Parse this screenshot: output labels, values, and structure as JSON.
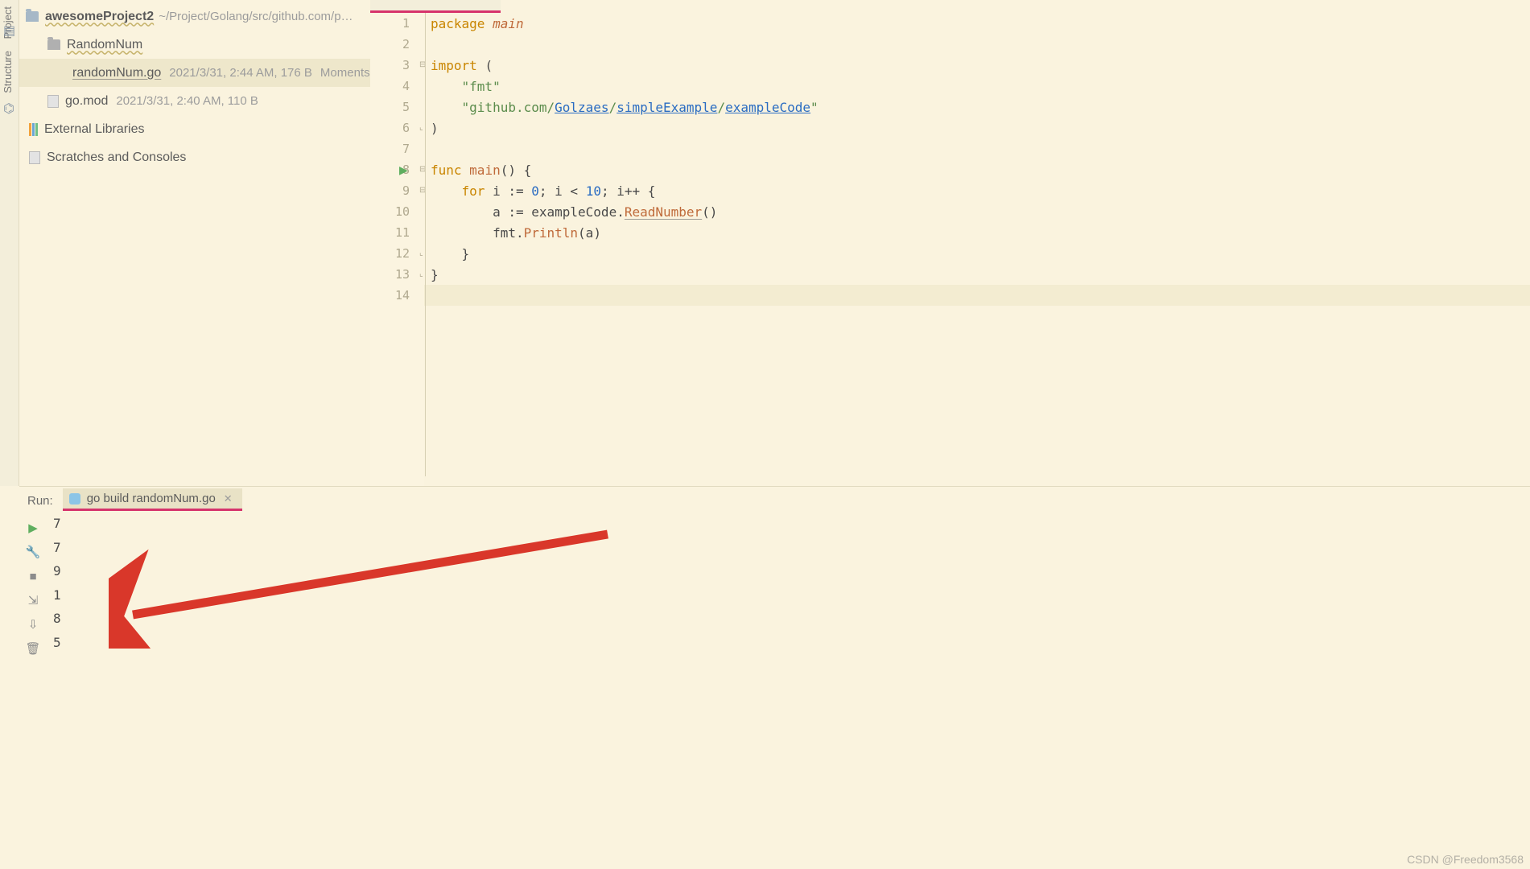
{
  "sidebar": {
    "project_tab": "Project",
    "structure_tab": "Structure"
  },
  "tree": {
    "root_name": "awesomeProject2",
    "root_path": "~/Project/Golang/src/github.com/p…",
    "pkg_name": "RandomNum",
    "file_name": "randomNum.go",
    "file_meta": "2021/3/31, 2:44 AM, 176 B",
    "file_meta2": "Moments ago",
    "gomod_name": "go.mod",
    "gomod_meta": "2021/3/31, 2:40 AM, 110 B",
    "external": "External Libraries",
    "scratches": "Scratches and Consoles"
  },
  "editor": {
    "lines": {
      "l1_kw": "package ",
      "l1_name": "main",
      "l3_kw": "import ",
      "l3_paren": "(",
      "l4": "    \"fmt\"",
      "l5_a": "    \"github.com/",
      "l5_b": "Golzaes",
      "l5_c": "/",
      "l5_d": "simpleExample",
      "l5_e": "/",
      "l5_f": "exampleCode",
      "l5_g": "\"",
      "l6": ")",
      "l8_a": "func ",
      "l8_b": "main",
      "l8_c": "() {",
      "l9_a": "    for ",
      "l9_b": "i",
      "l9_c": " := ",
      "l9_d": "0",
      "l9_e": "; ",
      "l9_f": "i",
      "l9_g": " < ",
      "l9_h": "10",
      "l9_i": "; ",
      "l9_j": "i",
      "l9_k": "++ {",
      "l10_a": "        a := ",
      "l10_b": "exampleCode",
      "l10_c": ".",
      "l10_d": "ReadNumber",
      "l10_e": "()",
      "l11_a": "        fmt.",
      "l11_b": "Println",
      "l11_c": "(",
      "l11_d": "a",
      "l11_e": ")",
      "l12": "    }",
      "l13": "}"
    },
    "line_numbers": [
      "1",
      "2",
      "3",
      "4",
      "5",
      "6",
      "7",
      "8",
      "9",
      "10",
      "11",
      "12",
      "13",
      "14"
    ]
  },
  "run": {
    "label": "Run:",
    "tab_title": "go build randomNum.go",
    "output": [
      "7",
      "7",
      "9",
      "1",
      "8",
      "5"
    ]
  },
  "watermark": "CSDN @Freedom3568"
}
